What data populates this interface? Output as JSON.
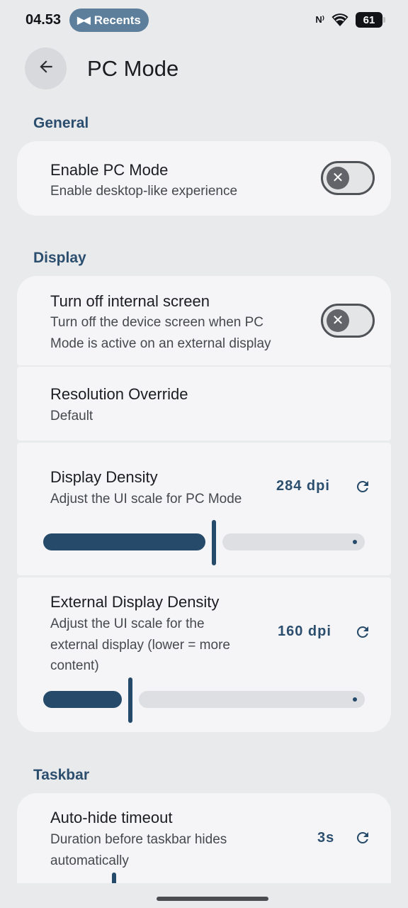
{
  "status": {
    "time": "04.53",
    "recents_label": "Recents",
    "nfc_label": "N",
    "battery": "61"
  },
  "header": {
    "title": "PC Mode"
  },
  "sections": {
    "general": "General",
    "display": "Display",
    "taskbar": "Taskbar"
  },
  "general": {
    "enable_pc_mode": {
      "title": "Enable PC Mode",
      "subtitle": "Enable desktop-like experience",
      "enabled": false
    }
  },
  "display": {
    "internal_screen": {
      "title": "Turn off internal screen",
      "subtitle_line1": "Turn off the device screen when PC",
      "subtitle_line2": "Mode is active on an external display",
      "enabled": false
    },
    "resolution": {
      "title": "Resolution Override",
      "value": "Default"
    },
    "density": {
      "title": "Display Density",
      "subtitle": "Adjust the UI scale for PC Mode",
      "value": "284  dpi",
      "slider_fraction": 0.53
    },
    "external_density": {
      "title": "External Display Density",
      "subtitle_line1": "Adjust the UI scale for the",
      "subtitle_line2": "external display (lower = more",
      "subtitle_line3": "content)",
      "value": "160  dpi",
      "slider_fraction": 0.27
    }
  },
  "taskbar": {
    "autohide": {
      "title": "Auto-hide timeout",
      "subtitle_line1": "Duration before taskbar hides",
      "subtitle_line2": "automatically",
      "value": "3s"
    }
  },
  "colors": {
    "accent": "#264a6a",
    "section_header": "#2b4e6e",
    "background": "#e9eaec",
    "card": "#f5f5f7"
  },
  "icons": {
    "back": "arrow-left-icon",
    "reset": "refresh-icon",
    "switch_off": "close-icon"
  }
}
